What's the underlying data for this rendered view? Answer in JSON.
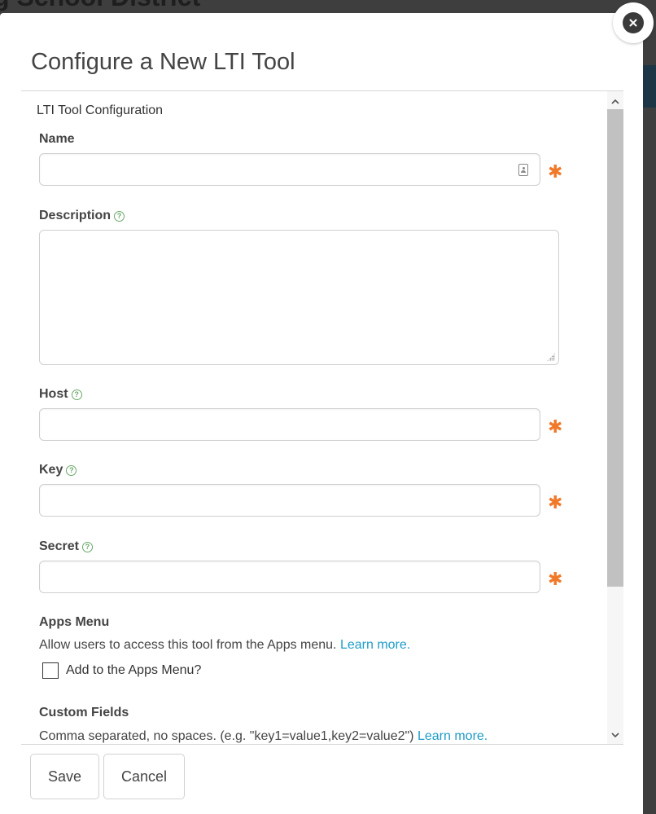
{
  "backdrop": {
    "title": "g School District"
  },
  "modal": {
    "title": "Configure a New LTI Tool",
    "close_icon": "close-icon"
  },
  "form": {
    "section_label": "LTI Tool Configuration",
    "name": {
      "label": "Name",
      "value": "",
      "required": true
    },
    "description": {
      "label": "Description",
      "value": ""
    },
    "host": {
      "label": "Host",
      "value": "",
      "required": true
    },
    "key": {
      "label": "Key",
      "value": "",
      "required": true
    },
    "secret": {
      "label": "Secret",
      "value": "",
      "required": true
    },
    "required_marker": "✱",
    "help_marker": "?",
    "apps_menu": {
      "label": "Apps Menu",
      "help_text": "Allow users to access this tool from the Apps menu.",
      "learn_more": "Learn more.",
      "checkbox_label": "Add to the Apps Menu?",
      "checked": false
    },
    "custom_fields": {
      "label": "Custom Fields",
      "help_text": "Comma separated, no spaces. (e.g. \"key1=value1,key2=value2\")",
      "learn_more": "Learn more."
    }
  },
  "footer": {
    "save_label": "Save",
    "cancel_label": "Cancel"
  },
  "colors": {
    "link": "#1d9cc8",
    "required": "#f07a2a",
    "help": "#6aa86a"
  }
}
